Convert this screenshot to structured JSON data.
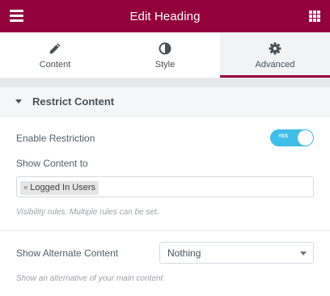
{
  "header": {
    "title": "Edit Heading",
    "menu_icon": "hamburger-menu-icon",
    "apps_icon": "grid-apps-icon",
    "bg_color": "#93003c"
  },
  "tabs": [
    {
      "label": "Content",
      "icon": "pencil-icon",
      "active": false
    },
    {
      "label": "Style",
      "icon": "half-circle-contrast-icon",
      "active": false
    },
    {
      "label": "Advanced",
      "icon": "gear-icon",
      "active": true
    }
  ],
  "section": {
    "title": "Restrict Content",
    "expanded": true
  },
  "enable_restriction": {
    "label": "Enable Restriction",
    "toggle_text": "YES",
    "enabled": true,
    "color": "#3fbee9"
  },
  "show_content_to": {
    "label": "Show Content to",
    "selected_tags": [
      "Logged In Users"
    ],
    "remove_glyph": "×",
    "description": "Visibility rules. Multiple rules can be set."
  },
  "alternate_content": {
    "label": "Show Alternate Content",
    "value": "Nothing",
    "description": "Show an alternative of your main content"
  }
}
